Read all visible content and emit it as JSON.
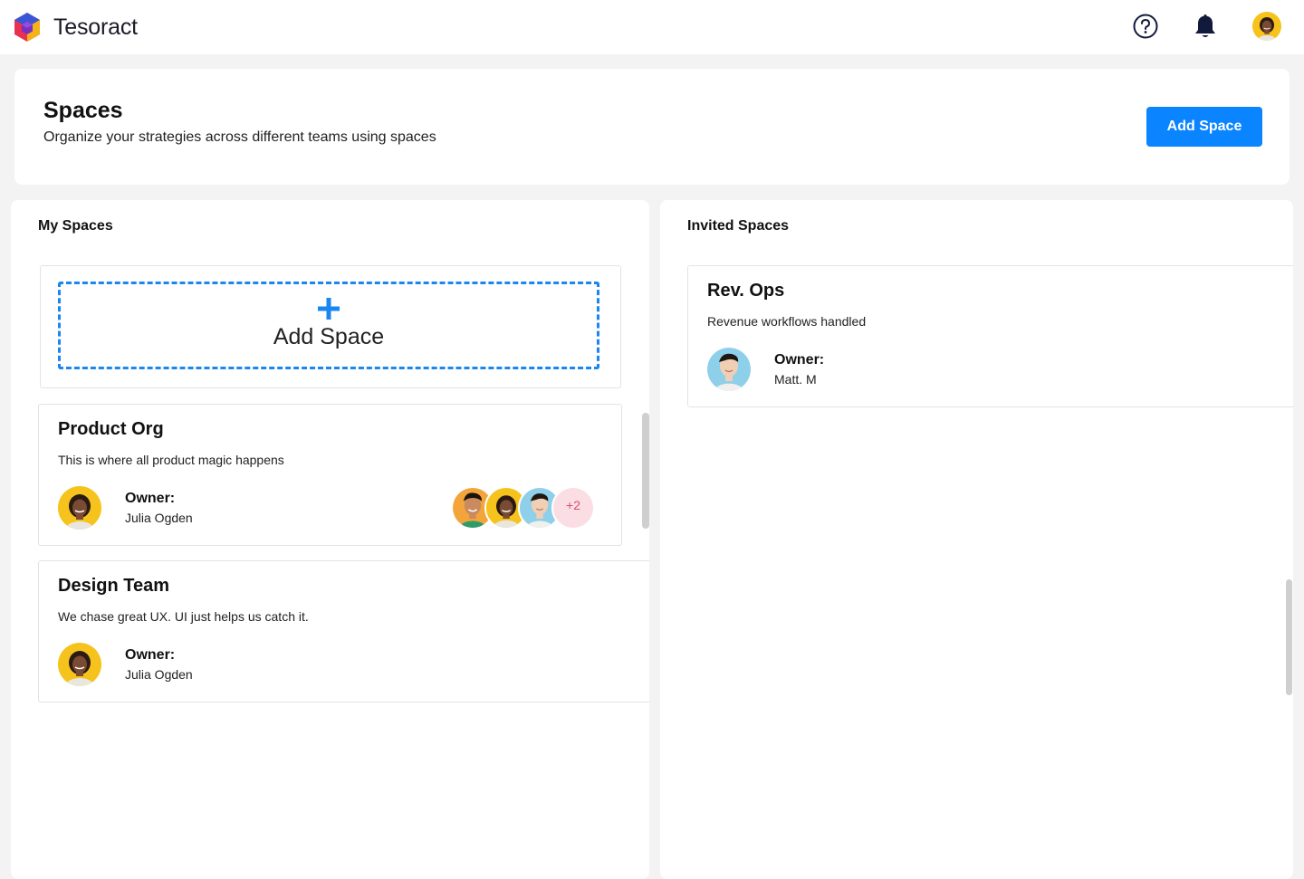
{
  "app": {
    "name": "Tesoract",
    "brand_colors": {
      "red": "#e8314f",
      "blue": "#3a56d6",
      "yellow": "#f5b21a",
      "purple": "#7b2fbf"
    }
  },
  "topbar": {
    "help_icon": "question-circle-icon",
    "bell_icon": "bell-icon",
    "avatar": "user-avatar"
  },
  "header": {
    "title": "Spaces",
    "subtitle": "Organize your strategies across different teams using spaces",
    "add_button_label": "Add Space",
    "accent_color": "#0a84ff"
  },
  "my_spaces": {
    "title": "My Spaces",
    "add_card": {
      "icon": "plus-icon",
      "label": "Add Space"
    },
    "cards": [
      {
        "title": "Product Org",
        "description": "This is where all product magic happens",
        "owner_label": "Owner:",
        "owner_name": "Julia Ogden",
        "members_extra": "+2"
      },
      {
        "title": "Design Team",
        "description": "We chase great UX. UI just helps us catch it.",
        "owner_label": "Owner:",
        "owner_name": "Julia Ogden"
      }
    ]
  },
  "invited_spaces": {
    "title": "Invited Spaces",
    "cards": [
      {
        "title": "Rev. Ops",
        "description": "Revenue workflows handled",
        "owner_label": "Owner:",
        "owner_name": "Matt. M"
      }
    ]
  }
}
